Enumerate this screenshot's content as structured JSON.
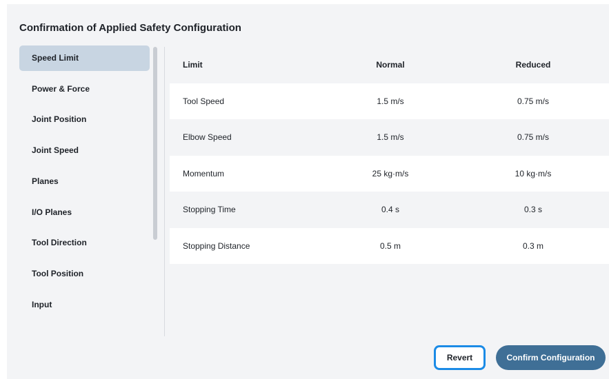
{
  "dialog": {
    "title": "Confirmation of Applied Safety Configuration"
  },
  "sidebar": {
    "items": [
      {
        "label": "Speed Limit",
        "active": true
      },
      {
        "label": "Power & Force",
        "active": false
      },
      {
        "label": "Joint Position",
        "active": false
      },
      {
        "label": "Joint Speed",
        "active": false
      },
      {
        "label": "Planes",
        "active": false
      },
      {
        "label": "I/O Planes",
        "active": false
      },
      {
        "label": "Tool Direction",
        "active": false
      },
      {
        "label": "Tool Position",
        "active": false
      },
      {
        "label": "Input",
        "active": false
      }
    ]
  },
  "table": {
    "headers": [
      "Limit",
      "Normal",
      "Reduced"
    ],
    "rows": [
      [
        "Tool Speed",
        "1.5 m/s",
        "0.75 m/s"
      ],
      [
        "Elbow Speed",
        "1.5 m/s",
        "0.75 m/s"
      ],
      [
        "Momentum",
        "25 kg·m/s",
        "10 kg·m/s"
      ],
      [
        "Stopping Time",
        "0.4 s",
        "0.3 s"
      ],
      [
        "Stopping Distance",
        "0.5 m",
        "0.3 m"
      ]
    ]
  },
  "buttons": {
    "revert_label": "Revert",
    "confirm_label": "Confirm Configuration"
  },
  "colors": {
    "active_item": "#c8d5e2",
    "focus_outline": "#1b8be6",
    "primary_button": "#3f6f96"
  }
}
